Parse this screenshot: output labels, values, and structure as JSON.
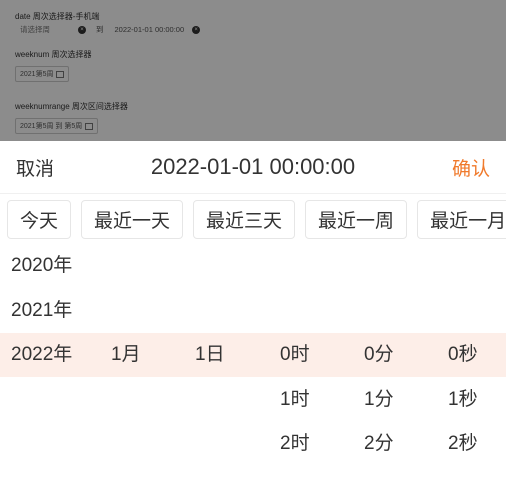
{
  "background": {
    "sections": [
      {
        "title": "date 周次选择器-手机端",
        "start_placeholder": "请选择周",
        "separator": "到",
        "end_value": "2022-01-01 00:00:00"
      },
      {
        "title": "weeknum 周次选择器",
        "value": "2021第5周"
      },
      {
        "title": "weeknumrange 周次区间选择器",
        "value": "2021第5周 到 第5周"
      }
    ]
  },
  "picker": {
    "cancel_label": "取消",
    "title": "2022-01-01 00:00:00",
    "confirm_label": "确认",
    "confirm_color": "#f07a2c",
    "highlight_color": "#fdeee8",
    "quick_options": [
      "今天",
      "最近一天",
      "最近三天",
      "最近一周",
      "最近一月"
    ],
    "columns": {
      "year": [
        "2020年",
        "2021年",
        "2022年"
      ],
      "month": [
        "",
        "",
        "1月"
      ],
      "day": [
        "",
        "",
        "1日"
      ],
      "hour": [
        "",
        "",
        "0时",
        "1时",
        "2时"
      ],
      "minute": [
        "",
        "",
        "0分",
        "1分",
        "2分"
      ],
      "second": [
        "",
        "",
        "0秒",
        "1秒",
        "2秒"
      ]
    }
  }
}
